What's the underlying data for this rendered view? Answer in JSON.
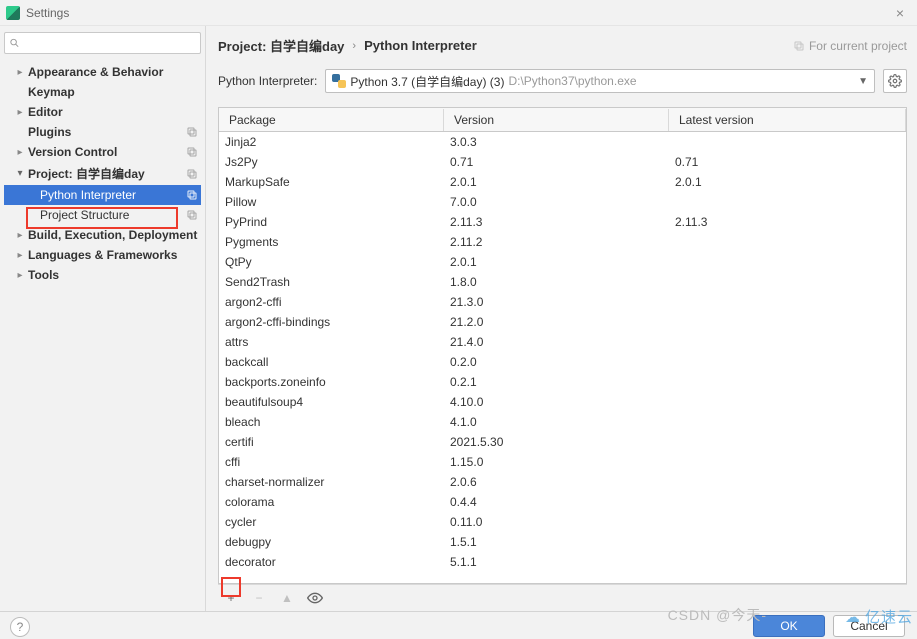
{
  "window": {
    "title": "Settings",
    "close": "×"
  },
  "search": {
    "placeholder": ""
  },
  "sidebar": {
    "items": [
      {
        "label": "Appearance & Behavior",
        "arrow": "right",
        "bold": true,
        "depth": 1
      },
      {
        "label": "Keymap",
        "arrow": "none",
        "bold": true,
        "depth": 1
      },
      {
        "label": "Editor",
        "arrow": "right",
        "bold": true,
        "depth": 1
      },
      {
        "label": "Plugins",
        "arrow": "none",
        "bold": true,
        "depth": 1,
        "badge": true
      },
      {
        "label": "Version Control",
        "arrow": "right",
        "bold": true,
        "depth": 1,
        "badge": true
      },
      {
        "label": "Project: 自学自编day",
        "arrow": "down",
        "bold": true,
        "depth": 1,
        "badge": true
      },
      {
        "label": "Python Interpreter",
        "arrow": "none",
        "bold": false,
        "depth": 2,
        "badge": true,
        "selected": true
      },
      {
        "label": "Project Structure",
        "arrow": "none",
        "bold": false,
        "depth": 2,
        "badge": true
      },
      {
        "label": "Build, Execution, Deployment",
        "arrow": "right",
        "bold": true,
        "depth": 1
      },
      {
        "label": "Languages & Frameworks",
        "arrow": "right",
        "bold": true,
        "depth": 1
      },
      {
        "label": "Tools",
        "arrow": "right",
        "bold": true,
        "depth": 1
      }
    ]
  },
  "breadcrumb": {
    "project": "Project: 自学自编day",
    "sep": "›",
    "current": "Python Interpreter",
    "scope": "For current project"
  },
  "interpreter": {
    "label": "Python Interpreter:",
    "name": "Python 3.7 (自学自编day) (3)",
    "path": "D:\\Python37\\python.exe"
  },
  "table": {
    "headers": {
      "package": "Package",
      "version": "Version",
      "latest": "Latest version"
    },
    "rows": [
      {
        "pkg": "Jinja2",
        "ver": "3.0.3",
        "lat": ""
      },
      {
        "pkg": "Js2Py",
        "ver": "0.71",
        "lat": "0.71"
      },
      {
        "pkg": "MarkupSafe",
        "ver": "2.0.1",
        "lat": "2.0.1"
      },
      {
        "pkg": "Pillow",
        "ver": "7.0.0",
        "lat": ""
      },
      {
        "pkg": "PyPrind",
        "ver": "2.11.3",
        "lat": "2.11.3"
      },
      {
        "pkg": "Pygments",
        "ver": "2.11.2",
        "lat": ""
      },
      {
        "pkg": "QtPy",
        "ver": "2.0.1",
        "lat": ""
      },
      {
        "pkg": "Send2Trash",
        "ver": "1.8.0",
        "lat": ""
      },
      {
        "pkg": "argon2-cffi",
        "ver": "21.3.0",
        "lat": ""
      },
      {
        "pkg": "argon2-cffi-bindings",
        "ver": "21.2.0",
        "lat": ""
      },
      {
        "pkg": "attrs",
        "ver": "21.4.0",
        "lat": ""
      },
      {
        "pkg": "backcall",
        "ver": "0.2.0",
        "lat": ""
      },
      {
        "pkg": "backports.zoneinfo",
        "ver": "0.2.1",
        "lat": ""
      },
      {
        "pkg": "beautifulsoup4",
        "ver": "4.10.0",
        "lat": ""
      },
      {
        "pkg": "bleach",
        "ver": "4.1.0",
        "lat": ""
      },
      {
        "pkg": "certifi",
        "ver": "2021.5.30",
        "lat": ""
      },
      {
        "pkg": "cffi",
        "ver": "1.15.0",
        "lat": ""
      },
      {
        "pkg": "charset-normalizer",
        "ver": "2.0.6",
        "lat": ""
      },
      {
        "pkg": "colorama",
        "ver": "0.4.4",
        "lat": ""
      },
      {
        "pkg": "cycler",
        "ver": "0.11.0",
        "lat": ""
      },
      {
        "pkg": "debugpy",
        "ver": "1.5.1",
        "lat": ""
      },
      {
        "pkg": "decorator",
        "ver": "5.1.1",
        "lat": ""
      }
    ]
  },
  "toolbar": {
    "add": "+",
    "remove": "−",
    "up": "▲",
    "eye": "◉"
  },
  "footer": {
    "ok": "OK",
    "cancel": "Cancel",
    "help": "?"
  },
  "watermark": {
    "center": "CSDN @今天-",
    "right": "亿速云"
  }
}
